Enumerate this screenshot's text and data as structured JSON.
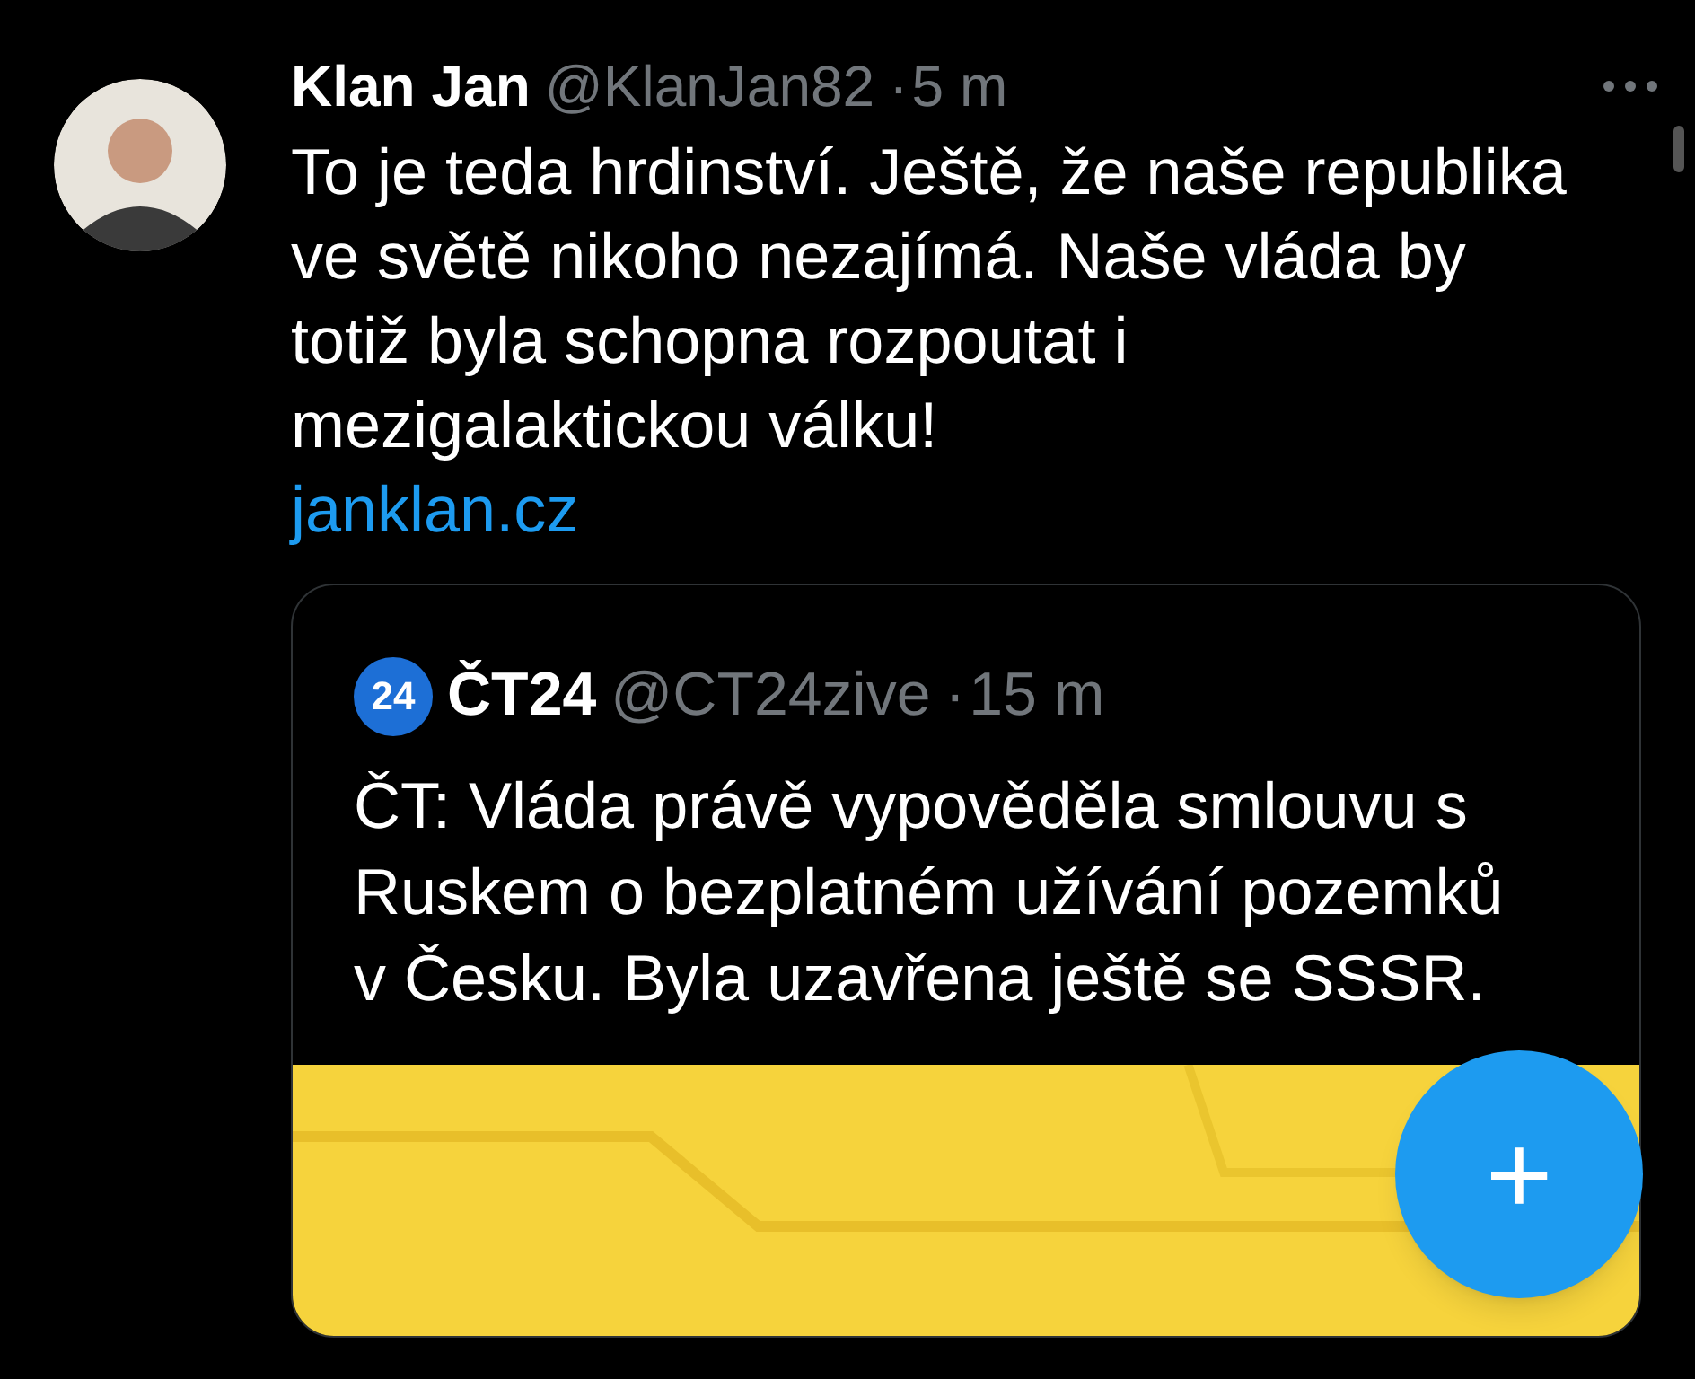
{
  "post": {
    "name": "Klan Jan",
    "handle": "@KlanJan82",
    "separator": "·",
    "time": "5 m",
    "text": "To je teda hrdinství. Ještě, že naše republika ve světě nikoho nezajímá. Naše vláda by totiž byla schopna rozpoutat i mezigalaktickou válku!",
    "link": "janklan.cz"
  },
  "quote": {
    "logo": "24",
    "name": "ČT24",
    "handle": "@CT24zive",
    "separator": "·",
    "time": "15 m",
    "text": "ČT: Vláda právě vypověděla smlouvu s Ruskem o bezplatném užívání pozemků v Česku. Byla uzavřena ještě se SSSR."
  },
  "fab": {
    "label": "+"
  }
}
